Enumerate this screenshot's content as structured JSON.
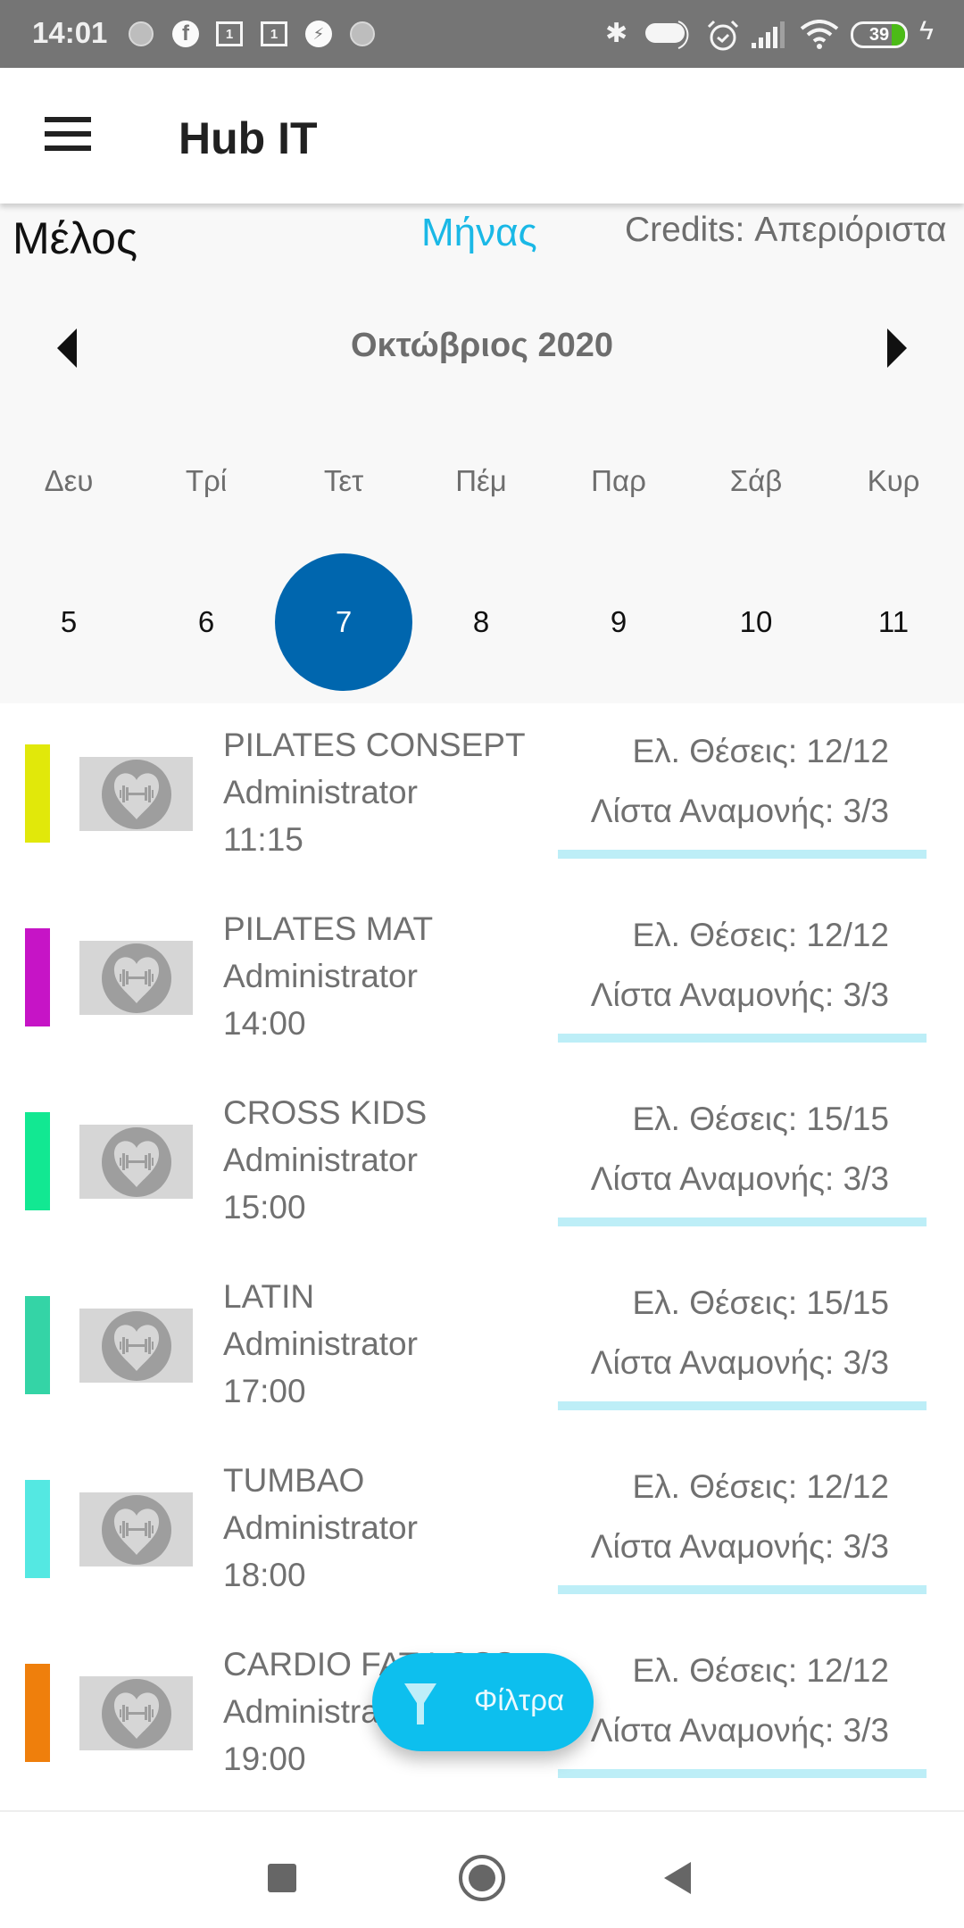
{
  "status_bar": {
    "time": "14:01",
    "left_icons": [
      "loading-dot-icon",
      "facebook-icon",
      "calendar-1-icon",
      "calendar-1-icon",
      "messenger-icon",
      "loading-dot-icon"
    ],
    "right_icons": [
      "bluetooth-icon",
      "toggle-icon",
      "alarm-icon",
      "signal-icon",
      "wifi-icon",
      "battery-icon",
      "charging-icon"
    ],
    "calendar_badge": "1",
    "battery_percent": 39
  },
  "app_bar": {
    "title": "Hub IT",
    "menu_icon": "hamburger-menu-icon"
  },
  "header": {
    "member_label": "Μέλος",
    "view_tab": "Μήνας",
    "credits": "Credits: Απεριόριστα",
    "month_title": "Οκτώβριος 2020",
    "prev_icon": "triangle-left-icon",
    "next_icon": "triangle-right-icon"
  },
  "week": {
    "weekdays": [
      "Δευ",
      "Τρί",
      "Τετ",
      "Πέμ",
      "Παρ",
      "Σάβ",
      "Κυρ"
    ],
    "days": [
      "5",
      "6",
      "7",
      "8",
      "9",
      "10",
      "11"
    ],
    "selected_day": "7",
    "selected_color": "#0066ae"
  },
  "classes": [
    {
      "name": "PILATES CONSEPT",
      "instructor": "Administrator",
      "time": "11:15",
      "seats": "Ελ. Θέσεις: 12/12",
      "waitlist": "Λίστα Αναμονής: 3/3",
      "color": "#e1e80a",
      "progress": 1.0
    },
    {
      "name": "PILATES MAT",
      "instructor": "Administrator",
      "time": "14:00",
      "seats": "Ελ. Θέσεις: 12/12",
      "waitlist": "Λίστα Αναμονής: 3/3",
      "color": "#c614c6",
      "progress": 1.0
    },
    {
      "name": "CROSS KIDS",
      "instructor": "Administrator",
      "time": "15:00",
      "seats": "Ελ. Θέσεις: 15/15",
      "waitlist": "Λίστα Αναμονής: 3/3",
      "color": "#12e892",
      "progress": 1.0
    },
    {
      "name": "LATIN",
      "instructor": "Administrator",
      "time": "17:00",
      "seats": "Ελ. Θέσεις: 15/15",
      "waitlist": "Λίστα Αναμονής: 3/3",
      "color": "#34d4a6",
      "progress": 1.0
    },
    {
      "name": "TUMBAO",
      "instructor": "Administrator",
      "time": "18:00",
      "seats": "Ελ. Θέσεις: 12/12",
      "waitlist": "Λίστα Αναμονής: 3/3",
      "color": "#54e8e2",
      "progress": 1.0
    },
    {
      "name": "CARDIO FAT LOSS",
      "instructor": "Administrator",
      "time": "19:00",
      "seats": "Ελ. Θέσεις: 12/12",
      "waitlist": "Λίστα Αναμονής: 3/3",
      "color": "#ef7f0c",
      "progress": 1.0
    }
  ],
  "fab": {
    "label": "Φίλτρα",
    "icon": "filter-icon",
    "color": "#0dbfee"
  },
  "nav_bar": {
    "buttons": [
      "recents-square-icon",
      "home-circle-icon",
      "back-triangle-icon"
    ]
  }
}
